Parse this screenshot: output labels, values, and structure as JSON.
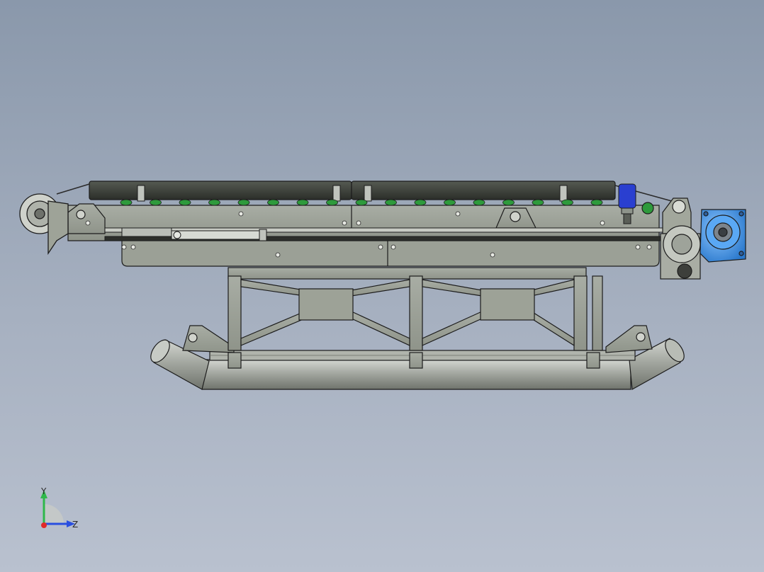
{
  "window": {
    "background_top": "#8a98ab",
    "background_bottom": "#b9c1cf"
  },
  "model": {
    "frame_color": "#9aa096",
    "belt_color": "#3c3f3a",
    "roller_color": "#2e9a3c",
    "motor_color": "#3a8ee0",
    "sensor_color": "#2a3fd0",
    "edge_color": "#1c1c1c",
    "roller_count": 17
  },
  "triad": {
    "y_label": "Y",
    "z_label": "Z",
    "y_color": "#2fb84a",
    "z_color": "#2a4fe0",
    "x_color": "#e02a2a"
  }
}
